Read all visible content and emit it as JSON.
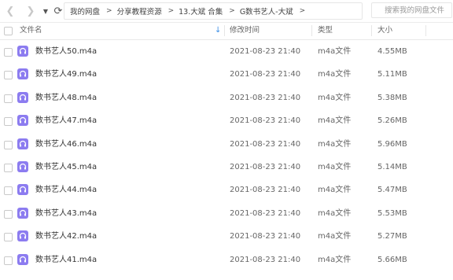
{
  "toolbar": {
    "back_icon": "chevron-left-icon",
    "forward_icon": "chevron-right-icon",
    "dropdown_icon": "caret-down-icon",
    "refresh_icon": "refresh-icon"
  },
  "breadcrumb": [
    {
      "label": "我的网盘"
    },
    {
      "label": "分享教程资源"
    },
    {
      "label": "13.大斌 合集"
    },
    {
      "label": "G数书艺人-大斌"
    }
  ],
  "search": {
    "placeholder": "搜索我的网盘文件"
  },
  "columns": {
    "name": "文件名",
    "mtime": "修改时间",
    "type": "类型",
    "size": "大小"
  },
  "colors": {
    "accent": "#3a8ee6",
    "audio_icon": "#8c7cf0"
  },
  "files": [
    {
      "name": "数书艺人50.m4a",
      "mtime": "2021-08-23 21:40",
      "type": "m4a文件",
      "size": "4.55MB",
      "icon": "audio-file-icon"
    },
    {
      "name": "数书艺人49.m4a",
      "mtime": "2021-08-23 21:40",
      "type": "m4a文件",
      "size": "5.11MB",
      "icon": "audio-file-icon"
    },
    {
      "name": "数书艺人48.m4a",
      "mtime": "2021-08-23 21:40",
      "type": "m4a文件",
      "size": "5.38MB",
      "icon": "audio-file-icon"
    },
    {
      "name": "数书艺人47.m4a",
      "mtime": "2021-08-23 21:40",
      "type": "m4a文件",
      "size": "5.26MB",
      "icon": "audio-file-icon"
    },
    {
      "name": "数书艺人46.m4a",
      "mtime": "2021-08-23 21:40",
      "type": "m4a文件",
      "size": "5.96MB",
      "icon": "audio-file-icon"
    },
    {
      "name": "数书艺人45.m4a",
      "mtime": "2021-08-23 21:40",
      "type": "m4a文件",
      "size": "5.14MB",
      "icon": "audio-file-icon"
    },
    {
      "name": "数书艺人44.m4a",
      "mtime": "2021-08-23 21:40",
      "type": "m4a文件",
      "size": "5.47MB",
      "icon": "audio-file-icon"
    },
    {
      "name": "数书艺人43.m4a",
      "mtime": "2021-08-23 21:40",
      "type": "m4a文件",
      "size": "5.53MB",
      "icon": "audio-file-icon"
    },
    {
      "name": "数书艺人42.m4a",
      "mtime": "2021-08-23 21:40",
      "type": "m4a文件",
      "size": "5.27MB",
      "icon": "audio-file-icon"
    },
    {
      "name": "数书艺人41.m4a",
      "mtime": "2021-08-23 21:40",
      "type": "m4a文件",
      "size": "5.66MB",
      "icon": "audio-file-icon"
    }
  ]
}
